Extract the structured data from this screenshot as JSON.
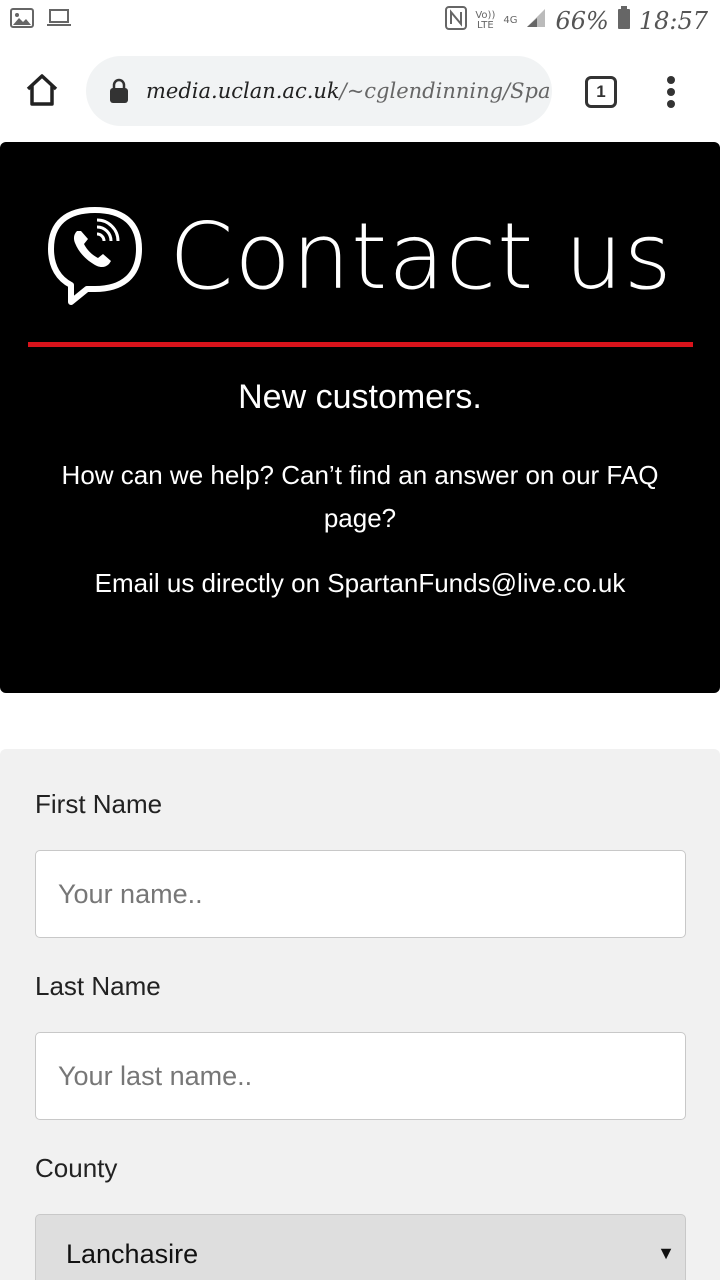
{
  "status_bar": {
    "volte_top": "Vo))",
    "volte_bottom": "LTE",
    "network": "4G",
    "battery": "66%",
    "time": "18:57"
  },
  "browser": {
    "url_host": "media.uclan.ac.uk",
    "url_path": "/~cglendinning/Spa",
    "tab_count": "1"
  },
  "hero": {
    "title": "Contact us",
    "subtitle": "New customers.",
    "help_text": "How can we help? Can’t find an answer on our FAQ page?",
    "email_text": "Email us directly on SpartanFunds@live.co.uk",
    "accent_color": "#d8131b"
  },
  "form": {
    "first_name_label": "First Name",
    "first_name_placeholder": "Your name..",
    "last_name_label": "Last Name",
    "last_name_placeholder": "Your last name..",
    "county_label": "County",
    "county_value": "Lanchasire"
  },
  "icons": [
    "image-icon",
    "laptop-icon",
    "nfc-icon",
    "signal-icon",
    "battery-icon",
    "home-icon",
    "lock-icon",
    "more-vert-icon",
    "phone-chat-icon",
    "chevron-down-icon"
  ]
}
